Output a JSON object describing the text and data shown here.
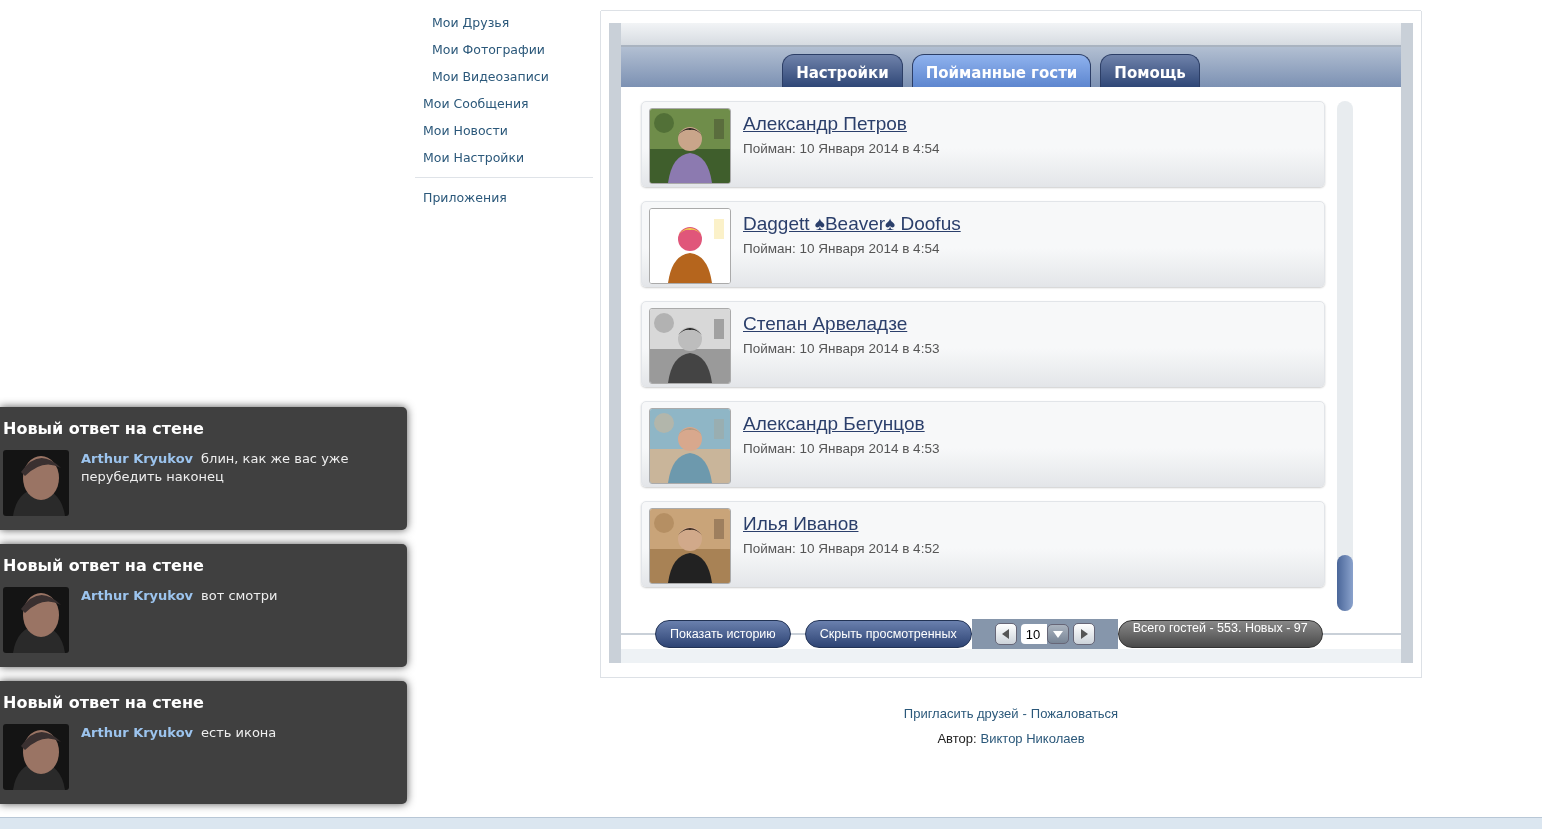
{
  "sidebar": {
    "subitems": [
      "Мои Друзья",
      "Мои Фотографии",
      "Мои Видеозаписи"
    ],
    "items": [
      "Мои Сообщения",
      "Мои Новости",
      "Мои Настройки"
    ],
    "apps": [
      "Приложения"
    ]
  },
  "tabs": [
    {
      "label": "Настройки",
      "selected": false
    },
    {
      "label": "Пойманные гости",
      "selected": true
    },
    {
      "label": "Помощь",
      "selected": false
    }
  ],
  "guests": [
    {
      "name": "Александр Петров",
      "caught": "Пойман: 10 Января 2014 в 4:54"
    },
    {
      "name": "Daggett ♠Beaver♠ Doofus",
      "caught": "Пойман: 10 Января 2014 в 4:54"
    },
    {
      "name": "Степан Арвеладзе",
      "caught": "Пойман: 10 Января 2014 в 4:53"
    },
    {
      "name": "Александр Бегунцов",
      "caught": "Пойман: 10 Января 2014 в 4:53"
    },
    {
      "name": "Илья Иванов",
      "caught": "Пойман: 10 Января 2014 в 4:52"
    }
  ],
  "controls": {
    "buttons": [
      "Показать историю",
      "Скрыть просмотренных"
    ],
    "page_size": "10",
    "total": "Всего гостей - 553. Новых - 97"
  },
  "footer": {
    "links": [
      "Пригласить друзей",
      "Пожаловаться"
    ],
    "separator": "-",
    "author_label": "Автор:",
    "author": "Виктор Николаев"
  },
  "notifications": [
    {
      "title": "Новый ответ на стене",
      "author": "Arthur Kryukov",
      "text": "блин, как же вас уже перубедить наконец"
    },
    {
      "title": "Новый ответ на стене",
      "author": "Arthur Kryukov",
      "text": "вот смотри"
    },
    {
      "title": "Новый ответ на стене",
      "author": "Arthur Kryukov",
      "text": "есть икона"
    }
  ]
}
